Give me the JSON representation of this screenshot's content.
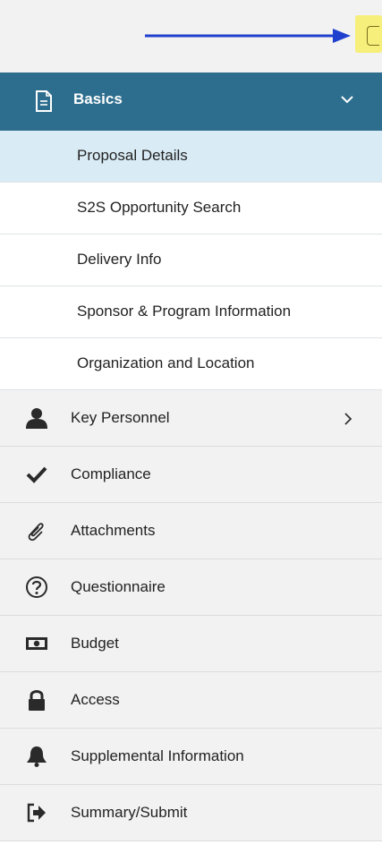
{
  "nav": {
    "basics": {
      "label": "Basics",
      "subitems": [
        {
          "label": "Proposal Details",
          "active": true
        },
        {
          "label": "S2S Opportunity Search"
        },
        {
          "label": "Delivery Info"
        },
        {
          "label": "Sponsor & Program Information"
        },
        {
          "label": "Organization and Location"
        }
      ]
    },
    "items": [
      {
        "label": "Key Personnel",
        "icon": "user-icon",
        "has_submenu": true
      },
      {
        "label": "Compliance",
        "icon": "check-icon"
      },
      {
        "label": "Attachments",
        "icon": "paperclip-icon"
      },
      {
        "label": "Questionnaire",
        "icon": "question-circle-icon"
      },
      {
        "label": "Budget",
        "icon": "money-icon"
      },
      {
        "label": "Access",
        "icon": "lock-icon"
      },
      {
        "label": "Supplemental Information",
        "icon": "bell-icon"
      },
      {
        "label": "Summary/Submit",
        "icon": "sign-in-icon"
      }
    ]
  },
  "colors": {
    "header_bg": "#2d6e8e",
    "active_bg": "#d9ecf6",
    "item_bg": "#f2f2f2",
    "annotation_arrow": "#1f3fcf",
    "highlight": "#f7ef7b"
  }
}
